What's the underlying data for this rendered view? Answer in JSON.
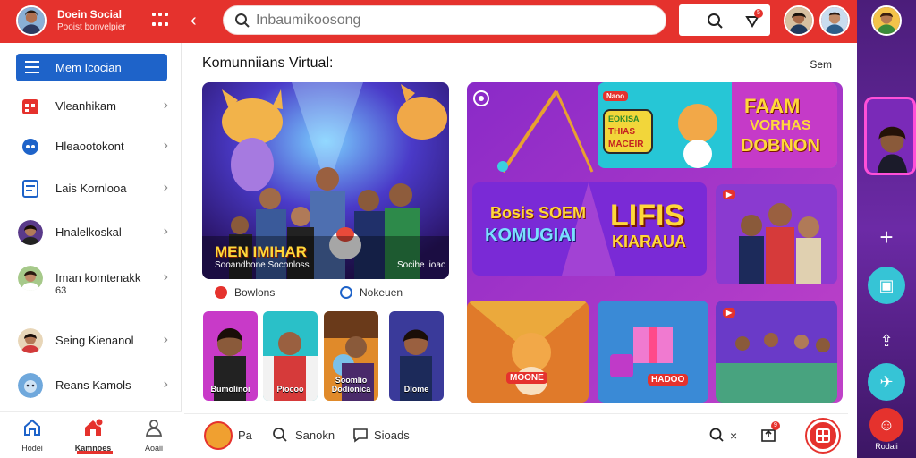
{
  "header": {
    "brand_name": "Doein Social",
    "brand_sub": "Pooist bonvelpier",
    "search_placeholder": "Inbaumikoosong",
    "notification_count": "5"
  },
  "sidebar": {
    "menu_label": "Mem Icocian",
    "items": [
      {
        "label": "Vleanhikam"
      },
      {
        "label": "Hleaootokont"
      },
      {
        "label": "Lais Kornlooa"
      },
      {
        "label": "Hnalelkoskal"
      },
      {
        "label": "Iman komtenakk",
        "sub": "63"
      },
      {
        "label": "Seing Kienanol"
      },
      {
        "label": "Reans Kamols"
      }
    ]
  },
  "bottom_nav": [
    {
      "label": "Hodei"
    },
    {
      "label": "Kamnoes"
    },
    {
      "label": "Aoaii"
    }
  ],
  "main": {
    "section_title": "Komunniians Virtual:",
    "see_all": "Sem",
    "hero": {
      "caption_title": "MEN IMIHAR",
      "caption_left": "Sooandbone Soconloss",
      "caption_right": "Socihe lioao"
    },
    "reactions": [
      {
        "label": "Bowlons"
      },
      {
        "label": "Nokeuen"
      }
    ],
    "thumbs": [
      {
        "caption": "Bumolinoi"
      },
      {
        "caption": "Piocoo"
      },
      {
        "caption": "Soomlio Dodionica"
      },
      {
        "caption": "Dlome"
      }
    ],
    "tiles": {
      "faam": [
        "FAAM",
        "VORHAS",
        "DOBNON"
      ],
      "sticker": [
        "EOKISA",
        "THIAS",
        "MACEIR"
      ],
      "bosis": [
        "Bosis SOEM",
        "KOMUGIAI"
      ],
      "lifis": [
        "LIFIS",
        "KIARAUA"
      ],
      "fox_badge": "MOONE",
      "gift_badge": "HADOO",
      "small_badge": "Naoo"
    }
  },
  "composer": {
    "post_label": "Pa",
    "search_label": "Sanokn",
    "chat_label": "Sioads",
    "notif_count": "9"
  },
  "rail": {
    "bottom_label": "Rodaii"
  }
}
